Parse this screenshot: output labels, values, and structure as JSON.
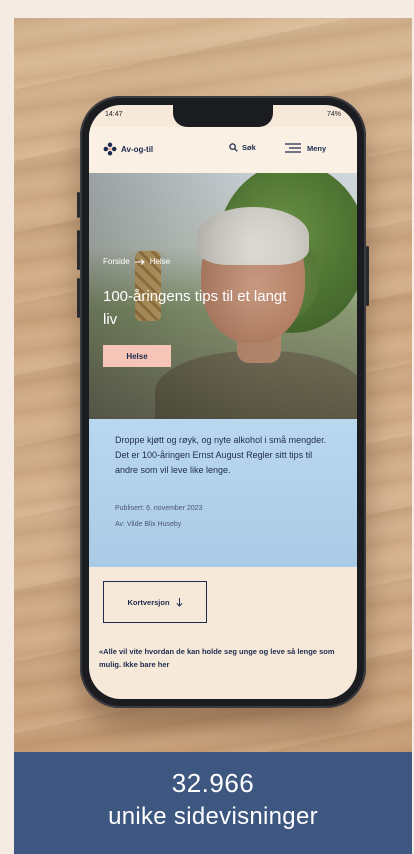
{
  "phone_status": {
    "time": "14:47",
    "battery": "74%"
  },
  "header": {
    "logo_text": "Av-og-til",
    "search_label": "Søk",
    "menu_label": "Meny"
  },
  "hero": {
    "breadcrumb": [
      "Forside",
      "Helse"
    ],
    "title": "100-åringens tips til et langt liv",
    "tag_label": "Helse"
  },
  "intro": {
    "text": "Droppe kjøtt og røyk, og nyte alkohol i små mengder. Det er 100-åringen Ernst August Regler sitt tips til andre som vil leve like lenge.",
    "published": "Publisert: 6. november 2023",
    "author": "Av: Vilde Blix Huseby"
  },
  "short_version_label": "Kortversjon",
  "quote": "«Alle vil vite hvordan de kan holde seg unge og leve så lenge som mulig. Ikke bare her",
  "stats": {
    "views": "32.966",
    "label": "unike sidevisninger"
  },
  "colors": {
    "caption_bg": "#3d5780",
    "intro_bg": "#b9d7ef",
    "tag_bg": "#f7c4b8",
    "navy": "#1d2b4d"
  },
  "icons": [
    "logo-flower-icon",
    "search-icon",
    "menu-icon",
    "arrow-right-icon",
    "arrow-down-icon"
  ]
}
